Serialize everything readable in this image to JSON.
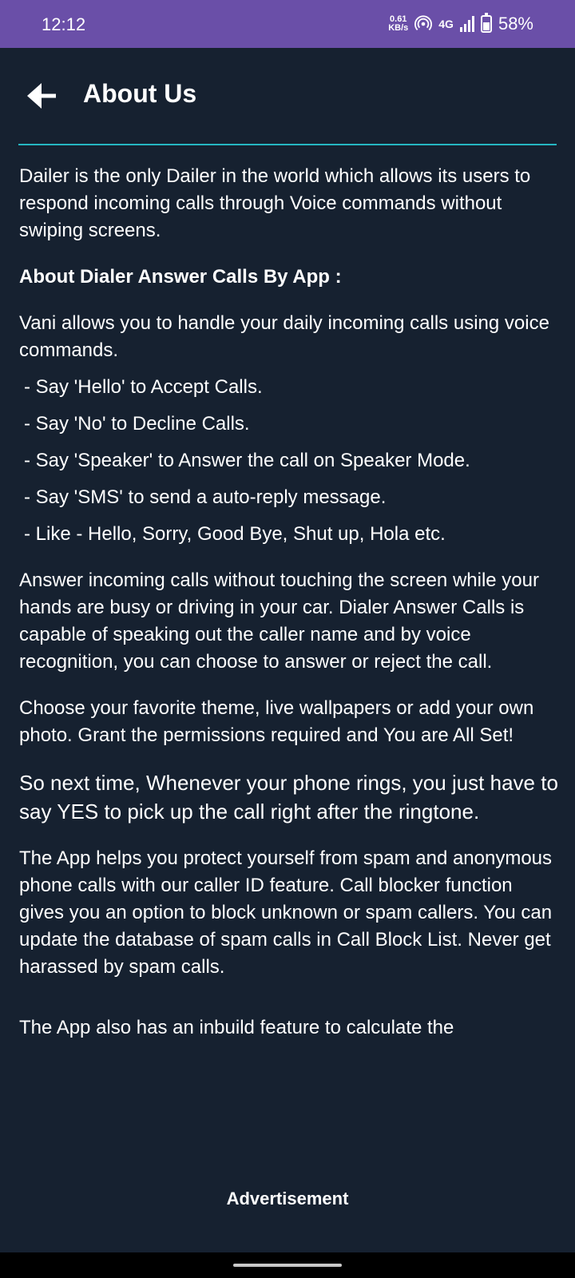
{
  "status_bar": {
    "time": "12:12",
    "net_speed_value": "0.61",
    "net_speed_unit": "KB/s",
    "network": "4G",
    "battery": "58%"
  },
  "header": {
    "title": "About Us"
  },
  "content": {
    "intro": "Dailer is the only Dailer in the world which allows its users to respond incoming calls through Voice commands without swiping screens.",
    "heading": "About Dialer Answer Calls By App :",
    "vani": "Vani allows you to handle your daily incoming calls using voice commands.",
    "bullets": [
      "- Say 'Hello' to Accept Calls.",
      "- Say 'No' to Decline Calls.",
      "- Say 'Speaker' to Answer the call on Speaker Mode.",
      "- Say 'SMS' to send a auto-reply message.",
      "- Like - Hello, Sorry, Good Bye, Shut up, Hola etc."
    ],
    "para_answer": "Answer incoming calls without touching the screen while your hands are busy or driving in your car. Dialer Answer Calls is capable of speaking out the caller name and by voice recognition, you can choose to answer or reject the call.",
    "para_theme": "Choose your favorite theme, live wallpapers or add your own photo. Grant the permissions required and You are All Set!",
    "para_next": "So next time, Whenever your phone rings, you just have to say YES to pick up the call right after the ringtone.",
    "para_spam": "The App helps you protect yourself from spam and anonymous phone calls with our caller ID feature. Call blocker function gives you an option to block unknown or spam callers. You can update the database of spam calls in Call Block List. Never get harassed by spam calls.",
    "para_inbuild": "The App also has an inbuild feature to calculate the"
  },
  "ad": {
    "label": "Advertisement"
  },
  "colors": {
    "status_bar_bg": "#6a4fa8",
    "background": "#162130",
    "divider": "#25b6c2"
  }
}
